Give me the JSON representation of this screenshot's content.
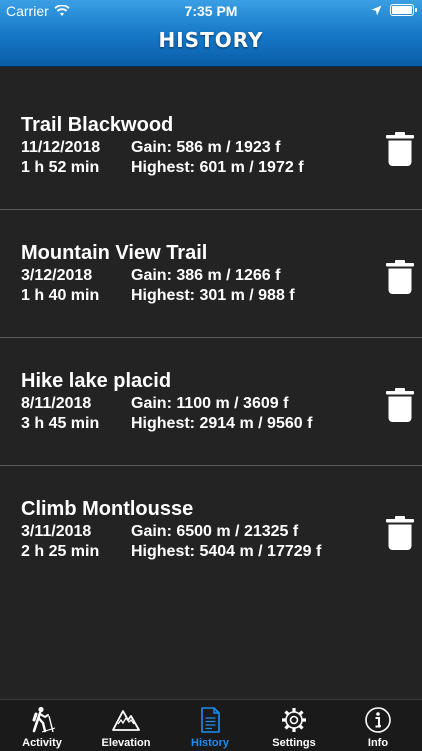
{
  "status": {
    "carrier": "Carrier",
    "time": "7:35 PM"
  },
  "header": {
    "title": "HISTORY"
  },
  "hikes": [
    {
      "name": "Trail Blackwood",
      "date": "11/12/2018",
      "gain": "Gain: 586 m / 1923 f",
      "duration": "1 h 52 min",
      "highest": "Highest: 601 m / 1972 f"
    },
    {
      "name": "Mountain View Trail",
      "date": "3/12/2018",
      "gain": "Gain: 386 m / 1266 f",
      "duration": "1 h 40 min",
      "highest": "Highest: 301 m / 988 f"
    },
    {
      "name": "Hike lake placid",
      "date": "8/11/2018",
      "gain": "Gain: 1100 m / 3609 f",
      "duration": "3 h 45 min",
      "highest": "Highest: 2914 m / 9560 f"
    },
    {
      "name": "Climb Montlousse",
      "date": "3/11/2018",
      "gain": "Gain: 6500 m / 21325 f",
      "duration": "2 h 25 min",
      "highest": "Highest: 5404 m / 17729 f"
    }
  ],
  "tabs": [
    {
      "label": "Activity",
      "icon": "hiker-icon"
    },
    {
      "label": "Elevation",
      "icon": "mountain-icon"
    },
    {
      "label": "History",
      "icon": "document-icon"
    },
    {
      "label": "Settings",
      "icon": "gear-icon"
    },
    {
      "label": "Info",
      "icon": "info-icon"
    }
  ],
  "colors": {
    "nav": "#1576c6",
    "active_tab": "#1d8cf0",
    "background": "#232323"
  }
}
